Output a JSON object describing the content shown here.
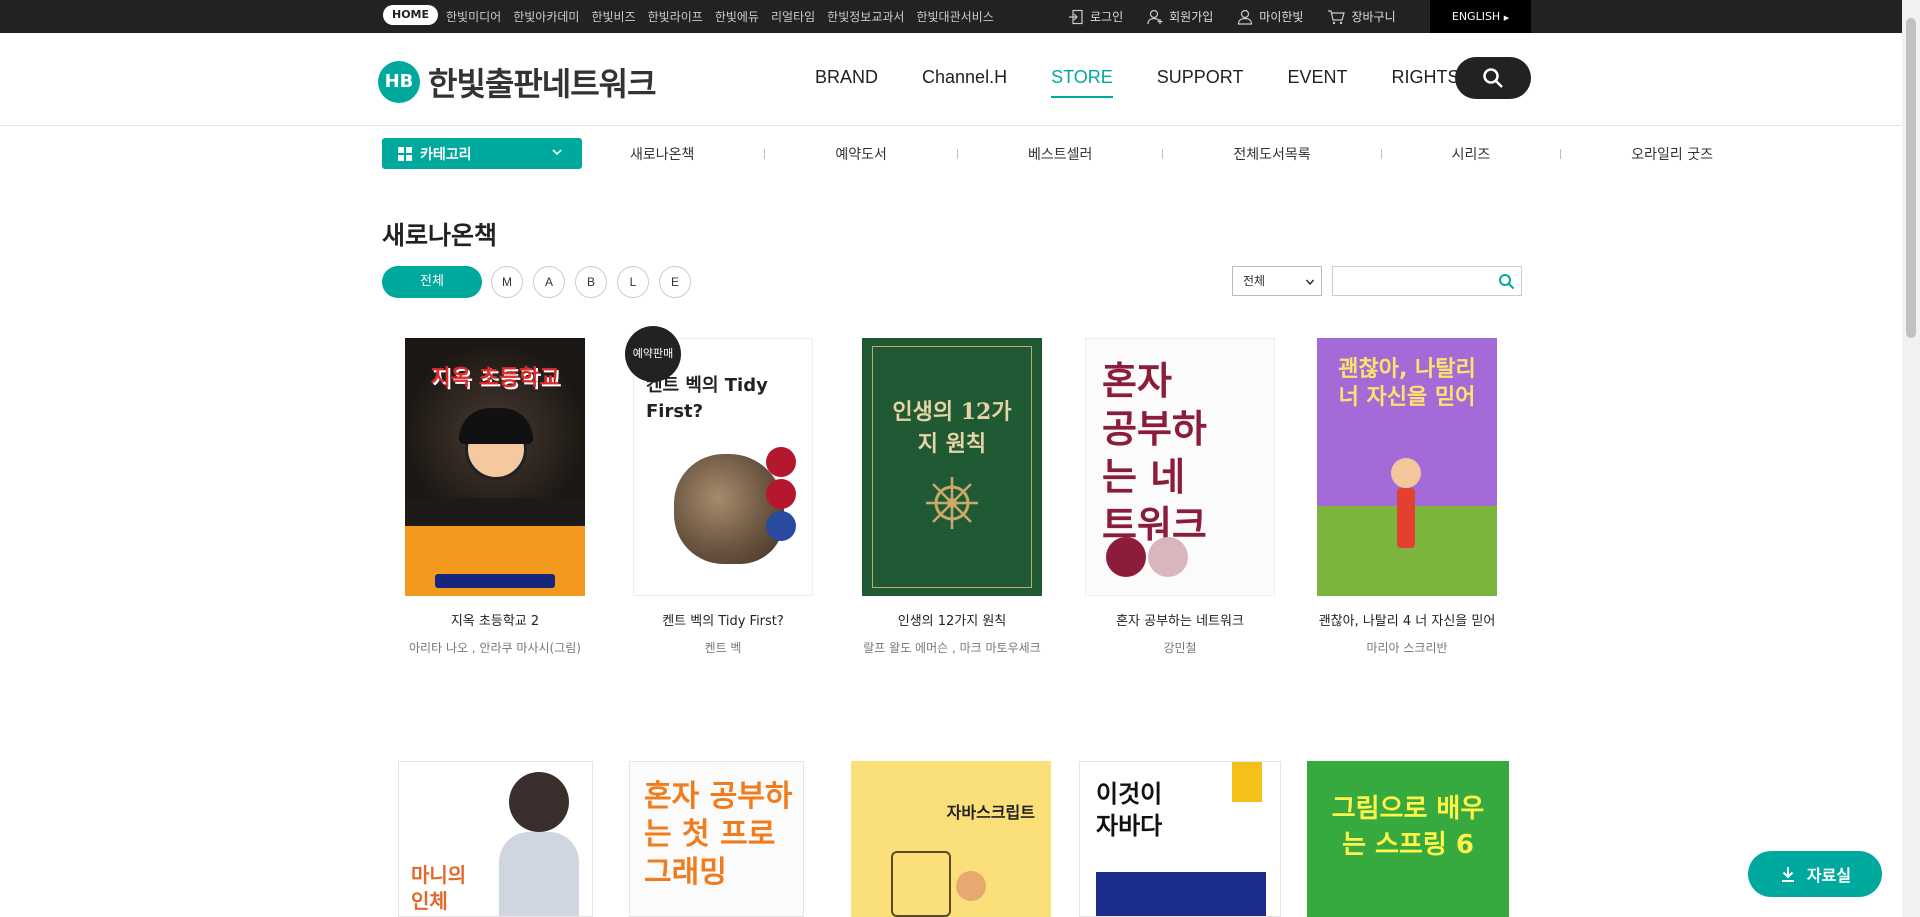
{
  "topbar": {
    "home_label": "HOME",
    "sites": [
      "한빛미디어",
      "한빛아카데미",
      "한빛비즈",
      "한빛라이프",
      "한빛에듀",
      "리얼타임",
      "한빛정보교과서",
      "한빛대관서비스"
    ],
    "util": {
      "login": "로그인",
      "signup": "회원가입",
      "mypage": "마이한빛",
      "cart": "장바구니"
    },
    "english": "ENGLISH"
  },
  "header": {
    "logo_text": "한빛출판네트워크",
    "logo_mark": "HB",
    "nav": [
      "BRAND",
      "Channel.H",
      "STORE",
      "SUPPORT",
      "EVENT",
      "RIGHTS"
    ],
    "active_nav": "STORE"
  },
  "subnav": {
    "category_label": "카테고리",
    "items": [
      "새로나온책",
      "예약도서",
      "베스트셀러",
      "전체도서목록",
      "시리즈",
      "오라일리 굿즈"
    ]
  },
  "page": {
    "title": "새로나온책",
    "filter_all": "전체",
    "filters": [
      "M",
      "A",
      "B",
      "L",
      "E"
    ],
    "select_value": "전체"
  },
  "books_row1": [
    {
      "title": "지옥 초등학교 2",
      "author": "아리타 나오 , 안라쿠 마사시(그림)",
      "cover_text": "지옥 초등학교"
    },
    {
      "title": "켄트 벡의 Tidy First?",
      "author": "켄트 벡",
      "cover_text": "켄트 벡의 Tidy First?",
      "badge": "예약판매"
    },
    {
      "title": "인생의 12가지 원칙",
      "author": "랄프 왈도 에머슨 , 마크 마토우세크",
      "cover_text": "인생의 12가지 원칙"
    },
    {
      "title": "혼자 공부하는 네트워크",
      "author": "강민철",
      "cover_text": "혼자 공부하는 네트워크"
    },
    {
      "title": "괜찮아, 나탈리 4 너 자신을 믿어",
      "author": "마리아 스크리반",
      "cover_text": "괜찮아, 나탈리 너 자신을 믿어"
    }
  ],
  "books_row2": [
    {
      "cover_text": "마니의 인체"
    },
    {
      "cover_text": "혼자 공부하는 첫 프로그래밍"
    },
    {
      "cover_text": "자바스크립트"
    },
    {
      "cover_text": "이것이 자바다"
    },
    {
      "cover_text": "그림으로 배우는 스프링 6"
    }
  ],
  "dataroom_label": "자료실",
  "colors": {
    "accent": "#00a99d",
    "dark": "#222222"
  }
}
